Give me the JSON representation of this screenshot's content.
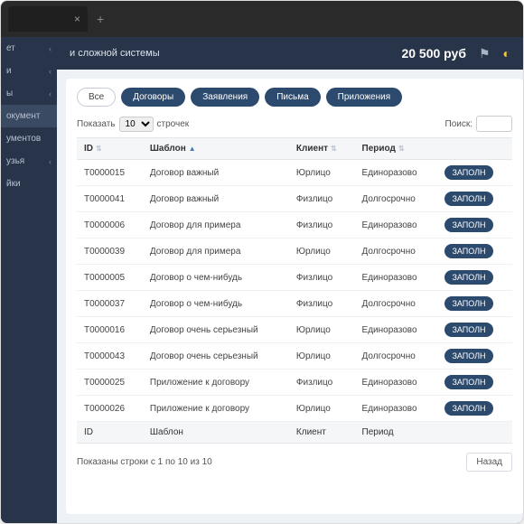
{
  "browser": {
    "plus": "+"
  },
  "topbar": {
    "brand_suffix": "и сложной системы",
    "balance": "20 500 руб"
  },
  "sidebar": {
    "items": [
      {
        "label": "ет"
      },
      {
        "label": "и"
      },
      {
        "label": "ы"
      },
      {
        "label": "окумент",
        "active": true
      },
      {
        "label": "ументов"
      },
      {
        "label": "узья"
      },
      {
        "label": "йки"
      }
    ]
  },
  "filters": [
    {
      "label": "Все",
      "variant": "outline"
    },
    {
      "label": "Договоры",
      "variant": "solid"
    },
    {
      "label": "Заявления",
      "variant": "solid"
    },
    {
      "label": "Письма",
      "variant": "solid"
    },
    {
      "label": "Приложения",
      "variant": "solid"
    }
  ],
  "length": {
    "prefix": "Показать",
    "value": "10",
    "suffix": "строчек"
  },
  "search": {
    "label": "Поиск:",
    "value": ""
  },
  "columns": {
    "id": "ID",
    "template": "Шаблон",
    "client": "Клиент",
    "period": "Период"
  },
  "rows": [
    {
      "id": "T0000015",
      "template": "Договор важный",
      "client": "Юрлицо",
      "period": "Единоразово"
    },
    {
      "id": "T0000041",
      "template": "Договор важный",
      "client": "Физлицо",
      "period": "Долгосрочно"
    },
    {
      "id": "T0000006",
      "template": "Договор для примера",
      "client": "Физлицо",
      "period": "Единоразово"
    },
    {
      "id": "T0000039",
      "template": "Договор для примера",
      "client": "Юрлицо",
      "period": "Долгосрочно"
    },
    {
      "id": "T0000005",
      "template": "Договор о чем-нибудь",
      "client": "Физлицо",
      "period": "Единоразово"
    },
    {
      "id": "T0000037",
      "template": "Договор о чем-нибудь",
      "client": "Физлицо",
      "period": "Долгосрочно"
    },
    {
      "id": "T0000016",
      "template": "Договор очень серьезный",
      "client": "Юрлицо",
      "period": "Единоразово"
    },
    {
      "id": "T0000043",
      "template": "Договор очень серьезный",
      "client": "Юрлицо",
      "period": "Долгосрочно"
    },
    {
      "id": "T0000025",
      "template": "Приложение к договору",
      "client": "Физлицо",
      "period": "Единоразово"
    },
    {
      "id": "T0000026",
      "template": "Приложение к договору",
      "client": "Юрлицо",
      "period": "Единоразово"
    }
  ],
  "action_label": "ЗАПОЛН",
  "pager": {
    "info": "Показаны строки с 1 по 10 из 10",
    "prev": "Назад"
  }
}
